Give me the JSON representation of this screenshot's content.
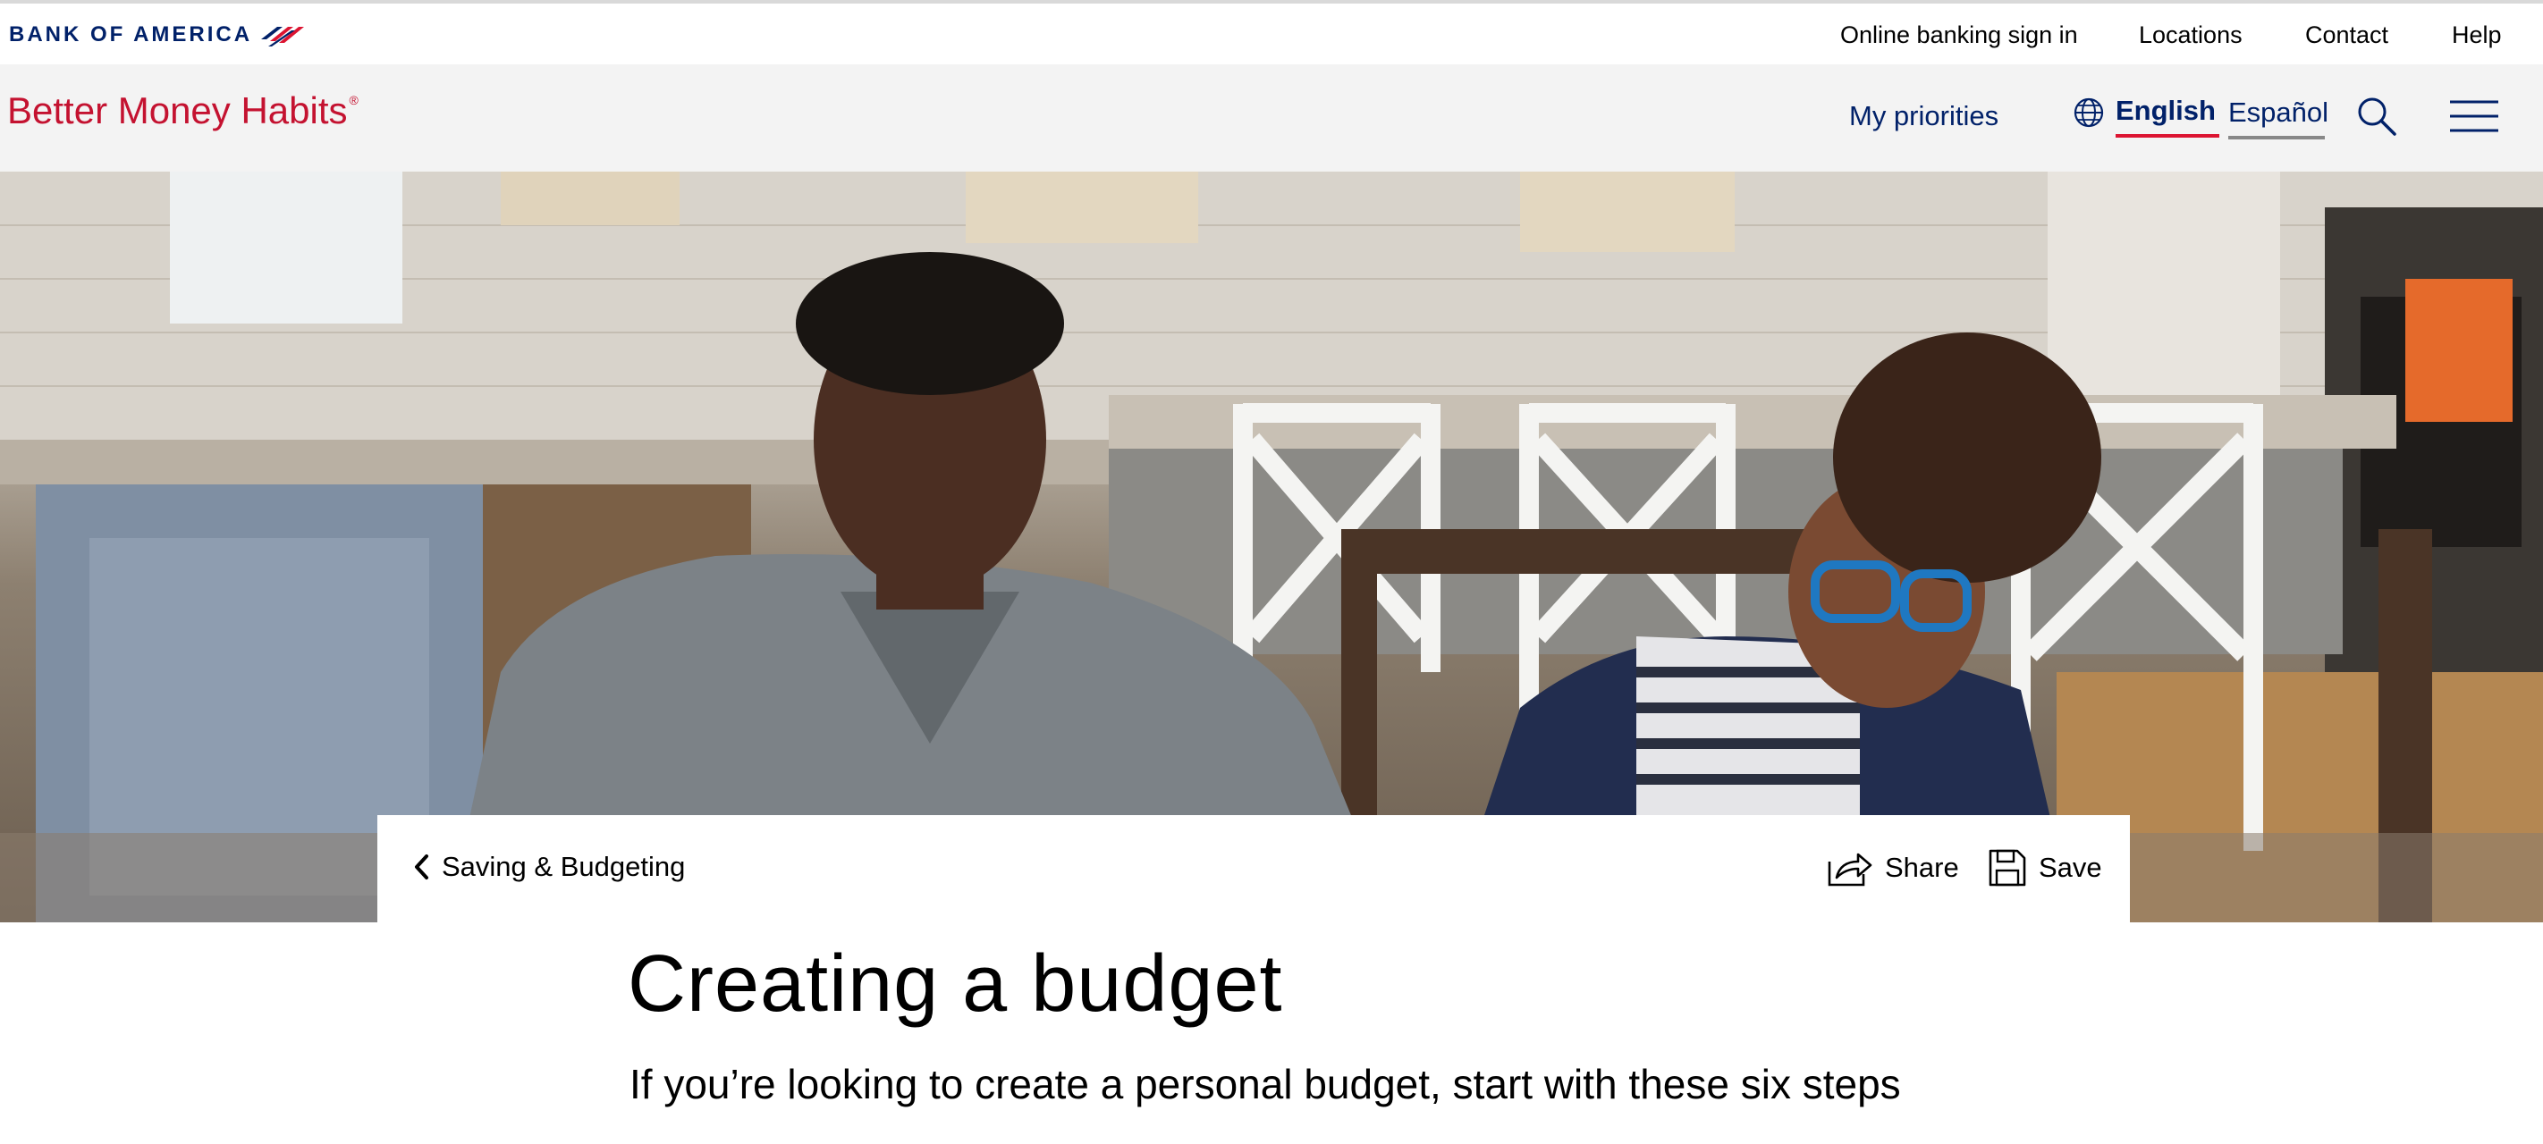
{
  "utility_bar": {
    "brand": "BANK OF AMERICA",
    "links": [
      "Online banking sign in",
      "Locations",
      "Contact",
      "Help"
    ]
  },
  "nav": {
    "site_name": "Better Money Habits",
    "site_mark": "®",
    "my_priorities": "My priorities",
    "lang_english": "English",
    "lang_espanol": "Español",
    "icons": [
      "globe-icon",
      "search-icon",
      "hamburger-menu-icon"
    ]
  },
  "hero": {
    "image_alt": "Father and daughter working at a kitchen table"
  },
  "article_bar": {
    "breadcrumb": "Saving & Budgeting",
    "share_label": "Share",
    "save_label": "Save"
  },
  "article": {
    "title": "Creating a budget",
    "subtitle": "If you’re looking to create a personal budget, start with these six steps"
  },
  "colors": {
    "brand_red": "#c41230",
    "brand_navy": "#012169",
    "nav_bg": "#f3f3f3"
  }
}
